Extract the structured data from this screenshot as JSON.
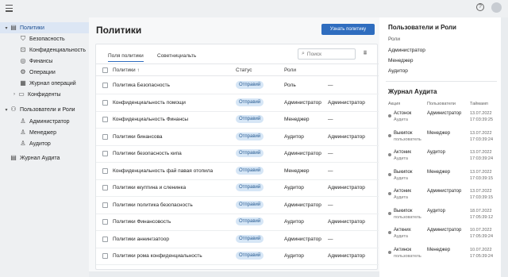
{
  "sidebar": {
    "items": [
      {
        "label": "Политики",
        "icon": "document-icon",
        "chevron": "▾",
        "active": true
      },
      {
        "label": "Безопасность",
        "icon": "shield-icon"
      },
      {
        "label": "Конфиденциальность",
        "icon": "lock-icon"
      },
      {
        "label": "Финансы",
        "icon": "coin-icon"
      },
      {
        "label": "Операции",
        "icon": "gear-icon"
      },
      {
        "label": "Журнал операций",
        "icon": "journal-icon"
      },
      {
        "label": "Конфиденты",
        "icon": "folder-icon",
        "chevron": "›"
      },
      {
        "label": "Пользователи и Роли",
        "icon": "users-icon",
        "chevron": "▾"
      },
      {
        "label": "Администратор",
        "icon": "user-icon"
      },
      {
        "label": "Менеджер",
        "icon": "user-icon"
      },
      {
        "label": "Аудитор",
        "icon": "user-icon"
      },
      {
        "label": "Журнал Аудита",
        "icon": "audit-log-icon"
      }
    ]
  },
  "main": {
    "title": "Политики",
    "primary_button": "Узнать политику",
    "tabs": [
      "Поля политики",
      "Советнициальть"
    ],
    "search_placeholder": "Поиск",
    "columns": [
      "Политики ↑",
      "Статус",
      "Роли",
      ""
    ],
    "rows": [
      {
        "name": "Политика Безопасность",
        "status": "Отправий",
        "role": "Роль",
        "role2": "—"
      },
      {
        "name": "Конфиденциальность помощи",
        "status": "Отправий",
        "role": "Администратор",
        "role2": "Администратор"
      },
      {
        "name": "Конфиденциальность Финансы",
        "status": "Отправий",
        "role": "Менеджер",
        "role2": "—"
      },
      {
        "name": "Политики бинансова",
        "status": "Отправий",
        "role": "Аудитор",
        "role2": "Администратор"
      },
      {
        "name": "Политики безопасность кипа",
        "status": "Отправий",
        "role": "Администратор",
        "role2": "—"
      },
      {
        "name": "Конфиденциальность фай павая отопила",
        "status": "Отправий",
        "role": "Менеджер",
        "role2": "—"
      },
      {
        "name": "Политики ккуптина и сленинка",
        "status": "Отправий",
        "role": "Аудитор",
        "role2": "Администратор"
      },
      {
        "name": "Политики политика безопасность",
        "status": "Отправий",
        "role": "Администратор",
        "role2": "—"
      },
      {
        "name": "Политики Финансовость",
        "status": "Отправий",
        "role": "Аудитор",
        "role2": "Администратор"
      },
      {
        "name": "Политики аннингзатоор",
        "status": "Отправий",
        "role": "Администратор",
        "role2": "—"
      },
      {
        "name": "Политики рома конфиденциальность",
        "status": "Отправий",
        "role": "Аудитор",
        "role2": "Администратор"
      }
    ]
  },
  "right_panel": {
    "roles_title": "Пользователи и Роли",
    "roles": [
      "Роли",
      "Администратор",
      "Менеджер",
      "Аудитор"
    ],
    "audit_title": "Журнал Аудита",
    "audit_headers": [
      "Акция",
      "Пользователи",
      "Таймамп"
    ],
    "audit_rows": [
      {
        "action": "Астонок",
        "sub": "Аудита",
        "user": "Администратор",
        "date": "13.07.2022",
        "time": "17:03:39:25"
      },
      {
        "action": "Выкипок",
        "sub": "пользователь",
        "user": "Менеджер",
        "date": "13.07.2022",
        "time": "17:03:39:24"
      },
      {
        "action": "Актоник",
        "sub": "Аудита",
        "user": "Аудитор",
        "date": "13.07.2022",
        "time": "17:03:39:24"
      },
      {
        "action": "Выкипок",
        "sub": "Аудита",
        "user": "Менеджер",
        "date": "13.07.2022",
        "time": "17:03:39:15"
      },
      {
        "action": "Актоник",
        "sub": "Аудита",
        "user": "Администратор",
        "date": "13.07.2022",
        "time": "17:03:39:15"
      },
      {
        "action": "Выкипок",
        "sub": "пользователь",
        "user": "Аудитор",
        "date": "18.07.2022",
        "time": "17:05:39:12"
      },
      {
        "action": "Акткних",
        "sub": "Аудита",
        "user": "Администратор",
        "date": "10.07.2022",
        "time": "17:05:39:24"
      },
      {
        "action": "Актинок",
        "sub": "пользователь",
        "user": "Менеджер",
        "date": "10.07.2022",
        "time": "17:05:39:24"
      }
    ]
  },
  "colors": {
    "accent": "#2f6dbf",
    "badge_bg": "#d6e6f6",
    "sidebar_active": "#dce6f4"
  }
}
